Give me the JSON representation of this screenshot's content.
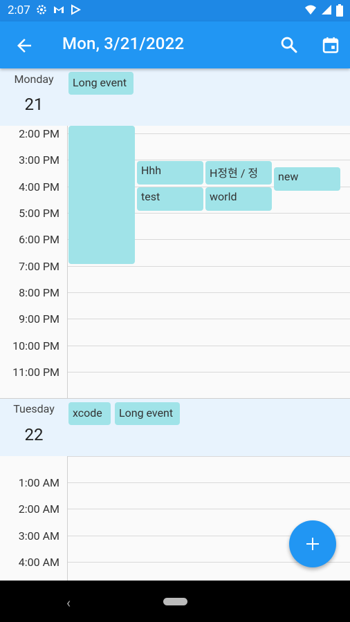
{
  "status_bar": {
    "time": "2:07",
    "left_icons": [
      "gear-icon",
      "gmail-icon",
      "play-icon"
    ],
    "right_icons": [
      "wifi-icon",
      "signal-icon",
      "battery-icon"
    ]
  },
  "app_bar": {
    "title": "Mon, 3/21/2022",
    "back_icon": "arrow-left-icon",
    "search_icon": "search-icon",
    "calendar_icon": "calendar-icon"
  },
  "days": [
    {
      "name": "Monday",
      "number": "21",
      "all_day_events": [
        "Long event"
      ],
      "hours": [
        "2:00 PM",
        "3:00 PM",
        "4:00 PM",
        "5:00 PM",
        "6:00 PM",
        "7:00 PM",
        "8:00 PM",
        "9:00 PM",
        "10:00 PM",
        "11:00 PM"
      ],
      "events": [
        "",
        "Hhh",
        "H정현 / 정",
        "new",
        "test",
        "world"
      ]
    },
    {
      "name": "Tuesday",
      "number": "22",
      "all_day_events": [
        "xcode",
        "Long event"
      ],
      "hours": [
        "1:00 AM",
        "2:00 AM",
        "3:00 AM",
        "4:00 AM"
      ]
    }
  ],
  "fab": {
    "icon": "plus-icon"
  },
  "colors": {
    "primary": "#2196f3",
    "status_bar": "#1e88e5",
    "event": "#a0e3e8",
    "day_header": "#e8f3fd"
  }
}
